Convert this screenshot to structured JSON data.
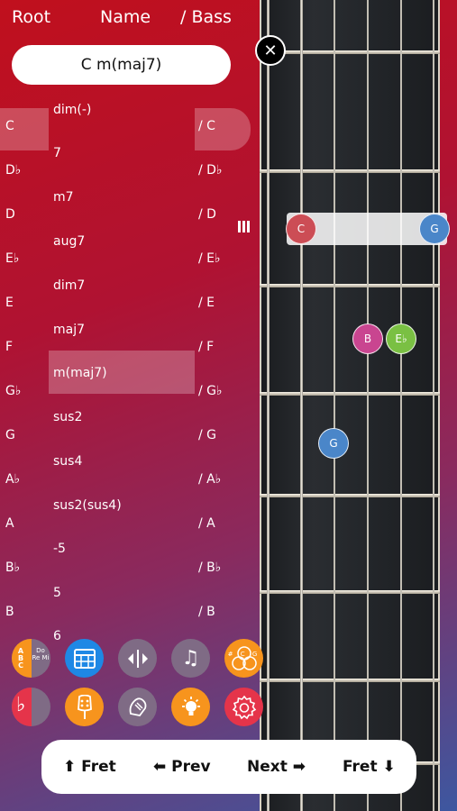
{
  "header": {
    "root_label": "Root",
    "name_label": "Name",
    "bass_label": "/ Bass"
  },
  "chord_field": {
    "value": "C m(maj7)"
  },
  "close_glyph": "✕",
  "roots": [
    "C",
    "D♭",
    "D",
    "E♭",
    "E",
    "F",
    "G♭",
    "G",
    "A♭",
    "A",
    "B♭",
    "B"
  ],
  "names": [
    "dim(-)",
    "7",
    "m7",
    "aug7",
    "dim7",
    "maj7",
    "m(maj7)",
    "sus2",
    "sus4",
    "sus2(sus4)",
    "-5",
    "5",
    "6"
  ],
  "basses": [
    "/ C",
    "/ D♭",
    "/ D",
    "/ E♭",
    "/ E",
    "/ F",
    "/ G♭",
    "/ G",
    "/ A♭",
    "/ A",
    "/ B♭",
    "/ B"
  ],
  "selected": {
    "root": "C",
    "name": "m(maj7)",
    "bass": "/ C"
  },
  "fretboard_notes": [
    {
      "label": "C",
      "color": "#cc4d55"
    },
    {
      "label": "G",
      "color": "#4a86c9"
    },
    {
      "label": "B",
      "color": "#c94590"
    },
    {
      "label": "E♭",
      "color": "#7ac043"
    },
    {
      "label": "G",
      "color": "#4a86c9"
    }
  ],
  "toolbar": {
    "do_re_mi_text": "Do Re Mi",
    "abc_text": "A B C",
    "circle_text": "# C G",
    "flat_glyph": "♭",
    "music_glyph": "♫"
  },
  "colors": {
    "orange": "#f7941d",
    "blue": "#1e88e5",
    "gray": "#7f6b85",
    "red": "#e5344a"
  },
  "nav": {
    "fret_up": "⬆ Fret",
    "prev": "⬅ Prev",
    "next": "Next ➡",
    "fret_down": "Fret ⬇"
  }
}
